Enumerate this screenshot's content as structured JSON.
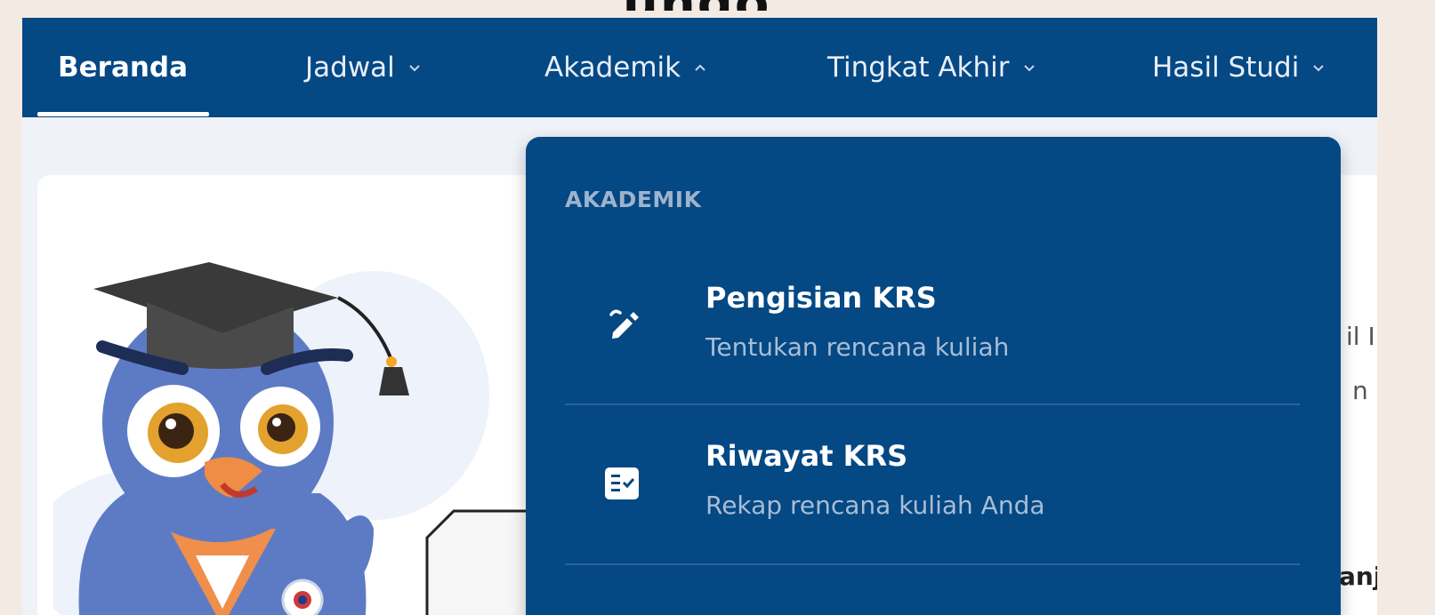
{
  "header_peek": "ungo",
  "nav": {
    "items": [
      {
        "label": "Beranda",
        "active": true
      },
      {
        "label": "Jadwal",
        "icon": "chevron-down-icon"
      },
      {
        "label": "Akademik",
        "icon": "chevron-up-icon"
      },
      {
        "label": "Tingkat Akhir",
        "icon": "chevron-down-icon"
      },
      {
        "label": "Hasil Studi",
        "icon": "chevron-down-icon"
      }
    ]
  },
  "dropdown": {
    "heading": "AKADEMIK",
    "items": [
      {
        "title": "Pengisian KRS",
        "description": "Tentukan rencana kuliah",
        "icon": "pencil-edit-icon"
      },
      {
        "title": "Riwayat KRS",
        "description": "Rekap rencana kuliah Anda",
        "icon": "checklist-icon"
      }
    ]
  },
  "background_text": {
    "line1": "il IP",
    "line2": "n s",
    "line3": "anj"
  },
  "colors": {
    "navbar": "#044884",
    "dropdown": "#044884",
    "heading": "#9eb3cc",
    "description": "#a9bdd4",
    "page_bg": "#f3ebe3"
  }
}
